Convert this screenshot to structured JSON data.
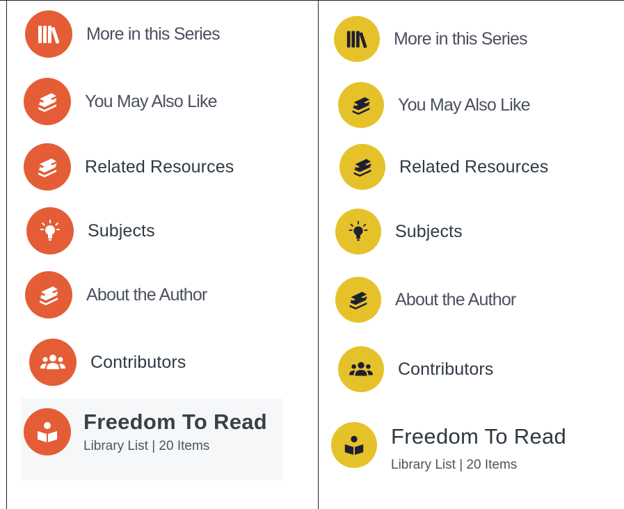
{
  "colors": {
    "left_accent": "#e45d36",
    "right_accent": "#e6c22a",
    "icon_dark": "#1f1f33"
  },
  "left_panel": {
    "items": [
      {
        "label": "More in this Series",
        "icon": "books-icon"
      },
      {
        "label": "You May Also Like",
        "icon": "book-stack-icon"
      },
      {
        "label": "Related Resources",
        "icon": "book-stack-icon"
      },
      {
        "label": "Subjects",
        "icon": "lightbulb-icon"
      },
      {
        "label": "About the Author",
        "icon": "book-stack-icon"
      },
      {
        "label": "Contributors",
        "icon": "users-icon"
      }
    ],
    "feature": {
      "title": "Freedom To Read",
      "subtitle": "Library List | 20 Items",
      "icon": "reader-icon"
    }
  },
  "right_panel": {
    "items": [
      {
        "label": "More in this Series",
        "icon": "books-icon"
      },
      {
        "label": "You May Also Like",
        "icon": "book-stack-icon"
      },
      {
        "label": "Related Resources",
        "icon": "book-stack-icon"
      },
      {
        "label": "Subjects",
        "icon": "lightbulb-icon"
      },
      {
        "label": "About the Author",
        "icon": "book-stack-icon"
      },
      {
        "label": "Contributors",
        "icon": "users-icon"
      }
    ],
    "feature": {
      "title": "Freedom To Read",
      "subtitle": "Library List | 20 Items",
      "icon": "reader-icon"
    }
  }
}
